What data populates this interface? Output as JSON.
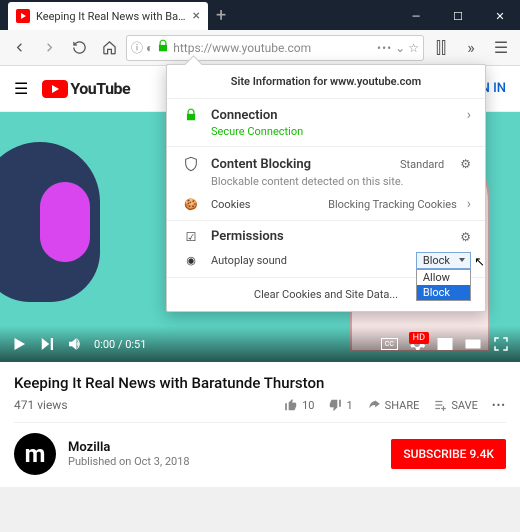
{
  "window": {
    "tab_title": "Keeping It Real News with Ba...",
    "controls": {
      "min": "—",
      "max": "☐",
      "close": "✕"
    }
  },
  "toolbar": {
    "url_display": "https://www.youtube.com"
  },
  "youtube": {
    "brand": "YouTube",
    "signin": "IN IN"
  },
  "player": {
    "time": "0:00 / 0:51",
    "cc": "cc"
  },
  "video": {
    "title": "Keeping It Real News with Baratunde Thurston",
    "views": "471 views",
    "likes": "10",
    "dislikes": "1",
    "share": "SHARE",
    "save": "SAVE"
  },
  "channel": {
    "avatar_letter": "m",
    "name": "Mozilla",
    "date": "Published on Oct 3, 2018",
    "subscribe_label": "SUBSCRIBE  9.4K"
  },
  "popup": {
    "header": "Site Information for www.youtube.com",
    "connection": {
      "title": "Connection",
      "status": "Secure Connection"
    },
    "blocking": {
      "title": "Content Blocking",
      "tag": "Standard",
      "desc": "Blockable content detected on this site.",
      "cookies_label": "Cookies",
      "cookies_value": "Blocking Tracking Cookies"
    },
    "permissions": {
      "title": "Permissions",
      "autoplay_label": "Autoplay sound",
      "selected": "Block",
      "options": [
        "Allow",
        "Block"
      ]
    },
    "footer": "Clear Cookies and Site Data..."
  }
}
